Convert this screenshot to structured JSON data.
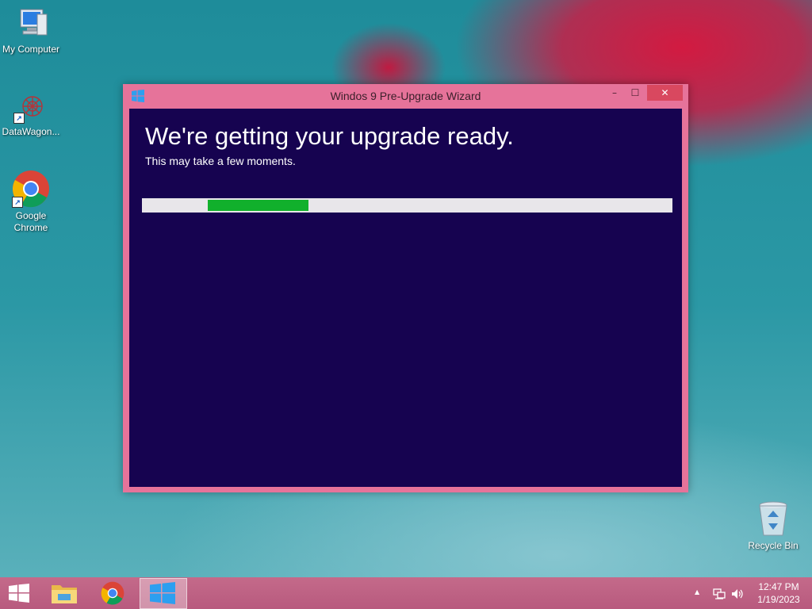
{
  "desktop": {
    "icons": [
      {
        "label": "My Computer"
      },
      {
        "label": "DataWagon..."
      },
      {
        "label": "Google Chrome"
      },
      {
        "label": "Recycle Bin"
      }
    ]
  },
  "window": {
    "title": "Windos 9 Pre-Upgrade Wizard",
    "minimize_glyph": "–",
    "maximize_glyph": "☐",
    "close_glyph": "✕",
    "heading": "We're getting your upgrade ready.",
    "subtext": "This may take a few moments.",
    "progress_fraction": 0.19,
    "frame_color": "#e6739a",
    "background_color": "#160350",
    "progress_color": "#11b02c"
  },
  "taskbar": {
    "items": [
      "start-button",
      "file-explorer",
      "google-chrome",
      "pre-upgrade-wizard"
    ],
    "tray": {
      "time": "12:47 PM",
      "date": "1/19/2023",
      "chevron": "▲"
    }
  }
}
